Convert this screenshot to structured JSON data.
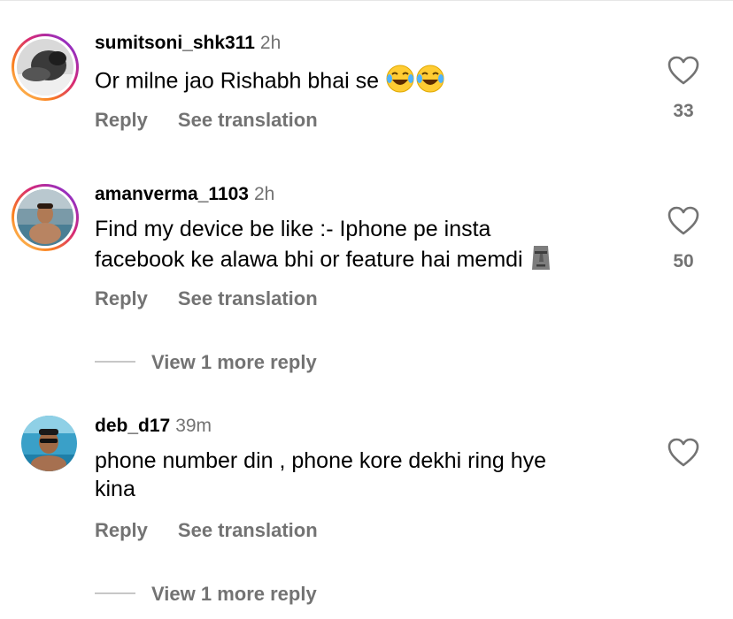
{
  "comments": [
    {
      "username": "sumitsoni_shk311",
      "time": "2h",
      "text": "Or milne jao Rishabh bhai se",
      "emoji": "face-with-tears-of-joy x2",
      "reply_label": "Reply",
      "translate_label": "See translation",
      "likes": "33"
    },
    {
      "username": "amanverma_1103",
      "time": "2h",
      "text_line1": "Find my device be like :- Iphone pe insta",
      "text_line2": "facebook ke alawa bhi or feature hai memdi",
      "emoji": "moai",
      "reply_label": "Reply",
      "translate_label": "See translation",
      "likes": "50",
      "more_replies": "View 1 more reply"
    },
    {
      "username": "deb_d17",
      "time": "39m",
      "text_line1": "phone number din , phone kore dekhi ring hye",
      "text_line2": "kina",
      "reply_label": "Reply",
      "translate_label": "See translation",
      "more_replies": "View 1 more reply"
    }
  ],
  "colors": {
    "secondary_text": "#737373",
    "primary_text": "#000000",
    "divider": "#c7c7c7"
  }
}
